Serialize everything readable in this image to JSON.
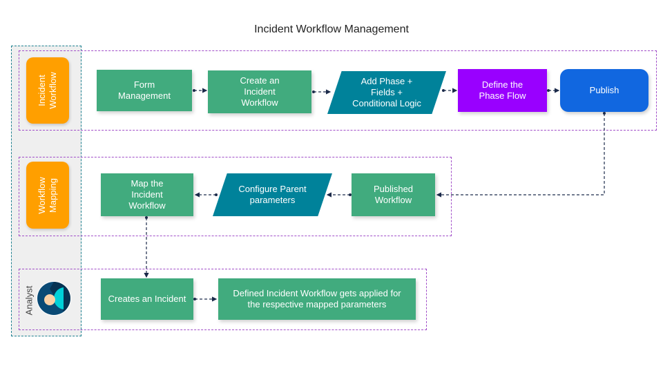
{
  "title": "Incident Workflow Management",
  "lanes": {
    "incident_workflow": {
      "label": "Incident\nWorkflow",
      "steps": [
        {
          "label": "Form\nManagement",
          "shape": "rectangle",
          "color": "#41ab7e"
        },
        {
          "label": "Create an\nIncident\nWorkflow",
          "shape": "rectangle",
          "color": "#41ab7e"
        },
        {
          "label": "Add Phase +\nFields +\nConditional Logic",
          "shape": "parallelogram",
          "color": "#00829a"
        },
        {
          "label": "Define the\nPhase Flow",
          "shape": "rectangle",
          "color": "#9900ff"
        },
        {
          "label": "Publish",
          "shape": "rounded-rectangle",
          "color": "#1167e0"
        }
      ]
    },
    "workflow_mapping": {
      "label": "Workflow\nMapping",
      "steps": [
        {
          "label": "Map the\nIncident\nWorkflow",
          "shape": "rectangle",
          "color": "#41ab7e"
        },
        {
          "label": "Configure Parent\nparameters",
          "shape": "parallelogram",
          "color": "#00829a"
        },
        {
          "label": "Published\nWorkflow",
          "shape": "rectangle",
          "color": "#41ab7e"
        }
      ]
    },
    "analyst": {
      "label": "Analyst",
      "icon": "analyst-avatar-icon",
      "steps": [
        {
          "label": "Creates an Incident",
          "shape": "rectangle",
          "color": "#41ab7e"
        },
        {
          "label": "Defined Incident Workflow gets applied for\nthe respective mapped parameters",
          "shape": "rectangle",
          "color": "#41ab7e"
        }
      ]
    }
  },
  "connections": [
    {
      "from": "Form Management",
      "to": "Create an Incident Workflow"
    },
    {
      "from": "Create an Incident Workflow",
      "to": "Add Phase + Fields + Conditional Logic"
    },
    {
      "from": "Add Phase + Fields + Conditional Logic",
      "to": "Define the Phase Flow"
    },
    {
      "from": "Define the Phase Flow",
      "to": "Publish"
    },
    {
      "from": "Publish",
      "to": "Published Workflow"
    },
    {
      "from": "Published Workflow",
      "to": "Configure Parent parameters"
    },
    {
      "from": "Configure Parent parameters",
      "to": "Map the Incident Workflow"
    },
    {
      "from": "Map the Incident Workflow",
      "to": "Creates an Incident"
    },
    {
      "from": "Creates an Incident",
      "to": "Defined Incident Workflow gets applied for the respective mapped parameters"
    }
  ],
  "colors": {
    "badge": "#ff9f00",
    "lane_border": "#a04cc8",
    "actor_border": "#1a7f8e",
    "connector": "#1b2a4a"
  }
}
